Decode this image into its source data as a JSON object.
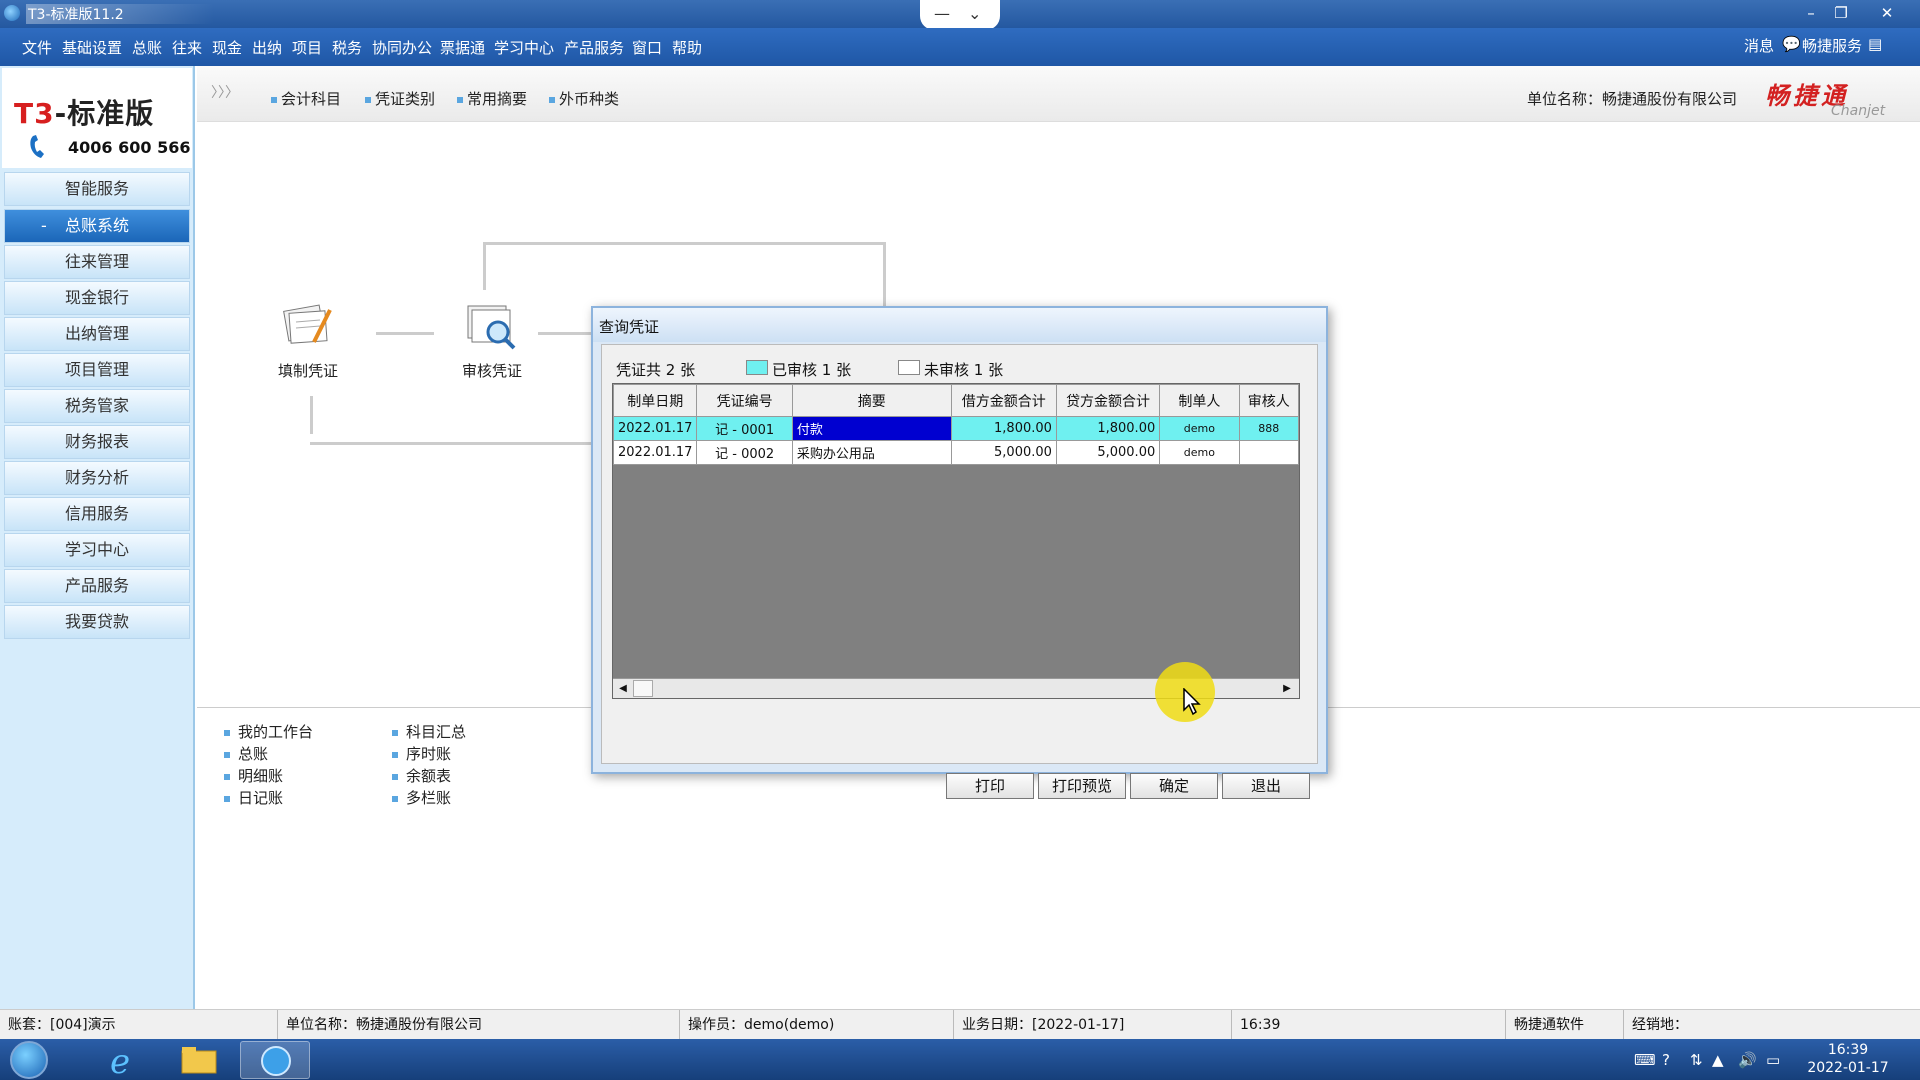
{
  "window": {
    "title": "T3-标准版11.2",
    "controls": {
      "minimize": "–",
      "restore": "❐",
      "close": "✕"
    }
  },
  "menu": {
    "items": [
      "文件",
      "基础设置",
      "总账",
      "往来",
      "现金",
      "出纳",
      "项目",
      "税务",
      "协同办公",
      "票据通",
      "学习中心",
      "产品服务",
      "窗口",
      "帮助"
    ],
    "right": {
      "message": "消息",
      "service": "畅捷服务"
    }
  },
  "logo": {
    "brand_prefix": "T3",
    "brand_rest": "-标准版",
    "phone": "4006 600 566"
  },
  "sidebar": {
    "items": [
      {
        "label": "智能服务",
        "active": false
      },
      {
        "label": "总账系统",
        "active": true,
        "prefix": "-"
      },
      {
        "label": "往来管理",
        "active": false
      },
      {
        "label": "现金银行",
        "active": false
      },
      {
        "label": "出纳管理",
        "active": false
      },
      {
        "label": "项目管理",
        "active": false
      },
      {
        "label": "税务管家",
        "active": false
      },
      {
        "label": "财务报表",
        "active": false
      },
      {
        "label": "财务分析",
        "active": false
      },
      {
        "label": "信用服务",
        "active": false
      },
      {
        "label": "学习中心",
        "active": false
      },
      {
        "label": "产品服务",
        "active": false
      },
      {
        "label": "我要贷款",
        "active": false
      }
    ]
  },
  "toolbar": {
    "chevron": "〉〉〉",
    "links": [
      "会计科目",
      "凭证类别",
      "常用摘要",
      "外币种类"
    ],
    "unit_name": "单位名称：畅捷通股份有限公司",
    "brand_cn": "畅捷通",
    "brand_en": "Chanjet"
  },
  "flow": {
    "fill_voucher": "填制凭证",
    "audit_voucher": "审核凭证"
  },
  "links": {
    "col1": [
      "我的工作台",
      "总账",
      "明细账",
      "日记账"
    ],
    "col2": [
      "科目汇总",
      "序时账",
      "余额表",
      "多栏账"
    ]
  },
  "dialog": {
    "title": "查询凭证",
    "total": "凭证共 2 张",
    "audited": "已审核 1 张",
    "unaudited": "未审核 1 张",
    "columns": [
      "制单日期",
      "凭证编号",
      "摘要",
      "借方金额合计",
      "贷方金额合计",
      "制单人",
      "审核人"
    ],
    "rows": [
      {
        "date": "2022.01.17",
        "no": "记 - 0001",
        "summary": "付款",
        "debit": "1,800.00",
        "credit": "1,800.00",
        "maker": "demo",
        "auditor": "888",
        "audited": true
      },
      {
        "date": "2022.01.17",
        "no": "记 - 0002",
        "summary": "采购办公用品",
        "debit": "5,000.00",
        "credit": "5,000.00",
        "maker": "demo",
        "auditor": "",
        "audited": false
      }
    ],
    "buttons": {
      "print": "打印",
      "preview": "打印预览",
      "ok": "确定",
      "exit": "退出"
    }
  },
  "status": {
    "account": "账套：[004]演示",
    "unit": "单位名称：畅捷通股份有限公司",
    "operator": "操作员：demo(demo)",
    "biz_date": "业务日期：[2022-01-17]",
    "time": "16:39",
    "vendor": "畅捷通软件",
    "dealer": "经销地："
  },
  "taskbar": {
    "time": "16:39",
    "date": "2022-01-17"
  },
  "colors": {
    "accent": "#1f57a6",
    "audited": "#6ff0f0",
    "selected": "#0000d0",
    "brand_red": "#d32121"
  }
}
